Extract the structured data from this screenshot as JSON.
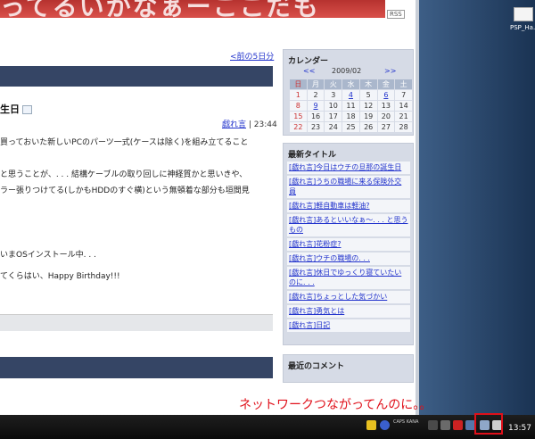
{
  "banner": {
    "text": "ってるいかなぁーここだも",
    "rss": "RSS"
  },
  "nav": {
    "prev_link": "<前の5日分"
  },
  "post": {
    "title": "生日",
    "category": "戯れ言",
    "time": "| 23:44",
    "lines": [
      "買っておいた新しいPCのパーツ一式(ケースは除く)を組み立てること",
      "",
      "と思うことが、. . . 結構ケーブルの取り回しに神経質かと思いきや、",
      "ラー張りつけてる(しかもHDDのすぐ横)という無頓着な部分も垣間見",
      "",
      "いまOSインストール中. . .",
      "てくらはい、Happy Birthday!!!"
    ]
  },
  "sidebar": {
    "calendar": {
      "title": "カレンダー",
      "prev": "<<",
      "month": "2009/02",
      "next": ">>",
      "weekdays": [
        "日",
        "月",
        "火",
        "水",
        "木",
        "金",
        "土"
      ],
      "weeks": [
        [
          "1",
          "2",
          "3",
          "4",
          "5",
          "6",
          "7"
        ],
        [
          "8",
          "9",
          "10",
          "11",
          "12",
          "13",
          "14"
        ],
        [
          "15",
          "16",
          "17",
          "18",
          "19",
          "20",
          "21"
        ],
        [
          "22",
          "23",
          "24",
          "25",
          "26",
          "27",
          "28"
        ]
      ]
    },
    "latest_titles": {
      "title": "最新タイトル",
      "items": [
        "[戯れ言]今日はウチの旦那の誕生日",
        "[戯れ言]うちの職場に来る保険外交員",
        "[戯れ言]軽自動車は軽油?",
        "[戯れ言]あるといいなぁ〜. . . と思うもの",
        "[戯れ言]花粉症?",
        "[戯れ言]ウチの職場の. . .",
        "[戯れ言]休日でゆっくり寝ていたいのに. . .",
        "[戯れ言]ちょっとした気づかい",
        "[戯れ言]勇気とは",
        "[戯れ言]日記"
      ]
    },
    "recent_comments": {
      "title": "最近のコメント"
    }
  },
  "desktop": {
    "icon_label": "PSP_Ha..."
  },
  "annotation": "ネットワークつながってんのに。。",
  "taskbar": {
    "clock": "13:57",
    "tray_small": "CAPS KANA"
  },
  "colors": {
    "highlight": "#e0101a",
    "header_bar": "#354565",
    "link": "#2233cc"
  }
}
